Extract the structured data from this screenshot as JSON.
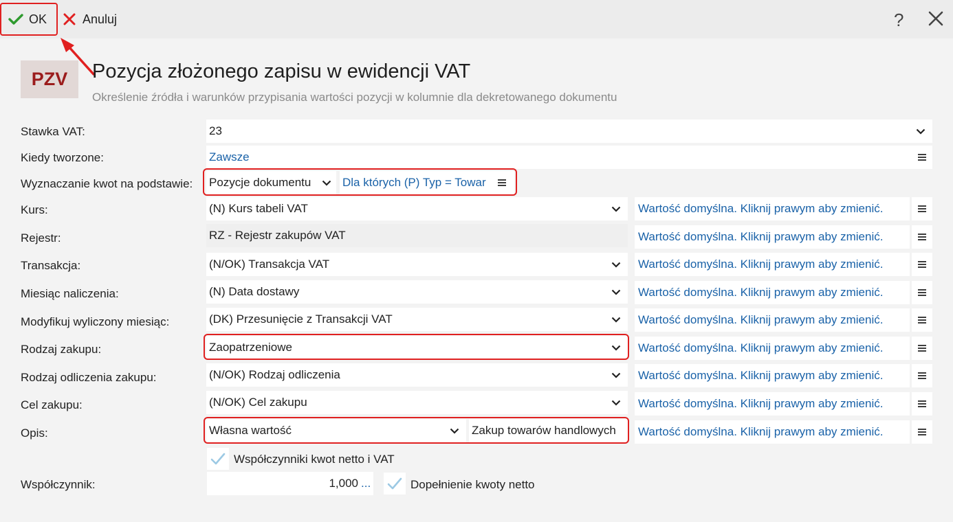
{
  "toolbar": {
    "ok_label": "OK",
    "cancel_label": "Anuluj",
    "help_label": "?"
  },
  "header": {
    "logo": "PZV",
    "title": "Pozycja złożonego zapisu w ewidencji VAT",
    "subtitle": "Określenie źródła i warunków przypisania wartości pozycji w kolumnie dla dekretowanego dokumentu"
  },
  "default_text": "Wartość domyślna. Kliknij prawym aby zmienić.",
  "form": {
    "stawka": {
      "label": "Stawka VAT:",
      "value": "23"
    },
    "kiedy": {
      "label": "Kiedy tworzone:",
      "value": "Zawsze"
    },
    "wyznaczanie": {
      "label": "Wyznaczanie kwot na podstawie:",
      "value": "Pozycje dokumentu",
      "filter": "Dla których (P) Typ = Towar"
    },
    "kurs": {
      "label": "Kurs:",
      "value": "(N) Kurs tabeli VAT"
    },
    "rejestr": {
      "label": "Rejestr:",
      "value": "RZ - Rejestr zakupów VAT"
    },
    "transakcja": {
      "label": "Transakcja:",
      "value": "(N/OK) Transakcja VAT"
    },
    "miesiac": {
      "label": "Miesiąc naliczenia:",
      "value": "(N) Data dostawy"
    },
    "modyfikuj": {
      "label": "Modyfikuj wyliczony miesiąc:",
      "value": "(DK) Przesunięcie z Transakcji VAT"
    },
    "rodzaj_zakupu": {
      "label": "Rodzaj zakupu:",
      "value": "Zaopatrzeniowe"
    },
    "rodzaj_odliczenia": {
      "label": "Rodzaj odliczenia zakupu:",
      "value": "(N/OK) Rodzaj odliczenia"
    },
    "cel": {
      "label": "Cel zakupu:",
      "value": "(N/OK) Cel zakupu"
    },
    "opis": {
      "label": "Opis:",
      "value": "Własna wartość",
      "text": "Zakup towarów handlowych"
    },
    "wspolczynniki_cb": {
      "label": "Współczynniki kwot netto i VAT",
      "checked": true
    },
    "wspolczynnik": {
      "label": "Współczynnik:",
      "value": "1,000",
      "dots": "..."
    },
    "dopelnienie_cb": {
      "label": "Dopełnienie kwoty netto",
      "checked": true
    }
  },
  "colors": {
    "accent_red": "#e02020",
    "link_blue": "#1a62a8",
    "logo_text": "#9b1c1c"
  }
}
